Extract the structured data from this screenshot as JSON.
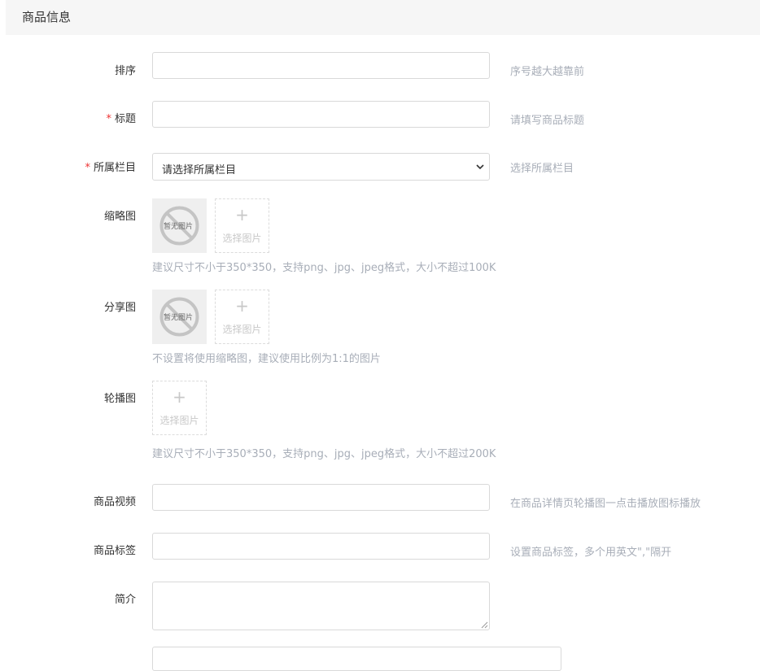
{
  "section": {
    "title": "商品信息"
  },
  "fields": {
    "sort": {
      "label": "排序",
      "value": "",
      "hint": "序号越大越靠前"
    },
    "title": {
      "required_mark": "*",
      "label": "标题",
      "value": "",
      "hint": "请填写商品标题"
    },
    "category": {
      "required_mark": "*",
      "label": "所属栏目",
      "selected": "请选择所属栏目",
      "hint": "选择所属栏目"
    },
    "thumbnail": {
      "label": "缩略图",
      "placeholder_text": "暂无图片",
      "upload_plus": "+",
      "upload_label": "选择图片",
      "help": "建议尺寸不小于350*350，支持png、jpg、jpeg格式，大小不超过100K"
    },
    "share_image": {
      "label": "分享图",
      "placeholder_text": "暂无图片",
      "upload_plus": "+",
      "upload_label": "选择图片",
      "help": "不设置将使用缩略图，建议使用比例为1:1的图片"
    },
    "carousel": {
      "label": "轮播图",
      "upload_plus": "+",
      "upload_label": "选择图片",
      "help": "建议尺寸不小于350*350，支持png、jpg、jpeg格式，大小不超过200K"
    },
    "video": {
      "label": "商品视频",
      "value": "",
      "hint": "在商品详情页轮播图一点击播放图标播放"
    },
    "tags": {
      "label": "商品标签",
      "value": "",
      "hint": "设置商品标签，多个用英文\",\"隔开"
    },
    "intro": {
      "label": "简介",
      "value": ""
    }
  },
  "colors": {
    "required": "#ee3333",
    "hint": "#a8aeb8",
    "border": "#d9d9d9",
    "header_bg": "#f6f6f6"
  }
}
